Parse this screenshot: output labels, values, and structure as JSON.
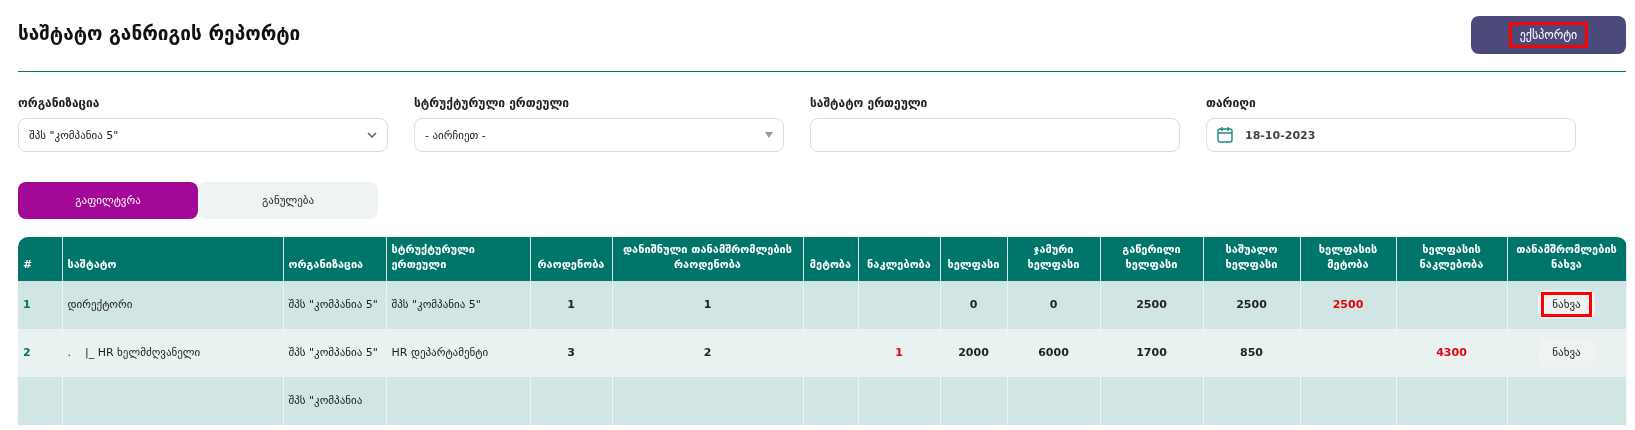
{
  "header": {
    "title": "საშტატო განრიგის რეპორტი",
    "export_button": {
      "label": "ექსპორტი",
      "highlighted": true
    }
  },
  "filters": [
    {
      "kind": "select",
      "label": "ორგანიზაცია",
      "value": "შპს \"კომპანია 5\""
    },
    {
      "kind": "combo",
      "label": "სტრუქტურული ერთეული",
      "value": "- აირჩიეთ -"
    },
    {
      "kind": "text",
      "label": "საშტატო ერთეული"
    },
    {
      "kind": "date",
      "label": "თარიღი",
      "value": "18-10-2023"
    }
  ],
  "actions": [
    {
      "label": "გაფილტვრა",
      "selected": true
    },
    {
      "label": "განულება",
      "selected": false
    }
  ],
  "table": {
    "columns": [
      {
        "label": "#",
        "kind": "index"
      },
      {
        "label": "საშტატო",
        "kind": "text"
      },
      {
        "label": "ორგანიზაცია",
        "kind": "text"
      },
      {
        "label": "სტრუქტურული ერთეული",
        "kind": "text"
      },
      {
        "label": "რაოდენობა",
        "kind": "number"
      },
      {
        "label": "დანიშნული თანამშრომლების რაოდენობა",
        "kind": "number"
      },
      {
        "label": "მეტობა",
        "kind": "alert"
      },
      {
        "label": "ნაკლებობა",
        "kind": "alert"
      },
      {
        "label": "ხელფასი",
        "kind": "number"
      },
      {
        "label": "ჯამური ხელფასი",
        "kind": "number"
      },
      {
        "label": "გაწერილი ხელფასი",
        "kind": "number"
      },
      {
        "label": "საშუალო ხელფასი",
        "kind": "number"
      },
      {
        "label": "ხელფასის მეტობა",
        "kind": "alert"
      },
      {
        "label": "ხელფასის ნაკლებობა",
        "kind": "alert"
      },
      {
        "label": "თანამშრომლების ნახვა",
        "kind": "action"
      }
    ],
    "rows": [
      {
        "cells": [
          "1",
          "დირექტორი",
          "შპს \"კომპანია 5\"",
          "შპს \"კომპანია 5\"",
          "1",
          "1",
          null,
          null,
          "0",
          "0",
          "2500",
          "2500",
          "2500",
          null
        ],
        "button": {
          "label": "ნახვა",
          "highlighted": true
        }
      },
      {
        "cells": [
          "2",
          ".    |_ HR ხელმძღვანელი",
          "შპს \"კომპანია 5\"",
          "HR დეპარტამენტი",
          "3",
          "2",
          null,
          "1",
          "2000",
          "6000",
          "1700",
          "850",
          null,
          "4300"
        ],
        "button": {
          "label": "ნახვა",
          "highlighted": false
        }
      },
      {
        "cells": [
          null,
          null,
          "შპს \"კომპანია",
          null,
          null,
          null,
          null,
          null,
          null,
          null,
          null,
          null,
          null,
          null
        ]
      }
    ]
  }
}
